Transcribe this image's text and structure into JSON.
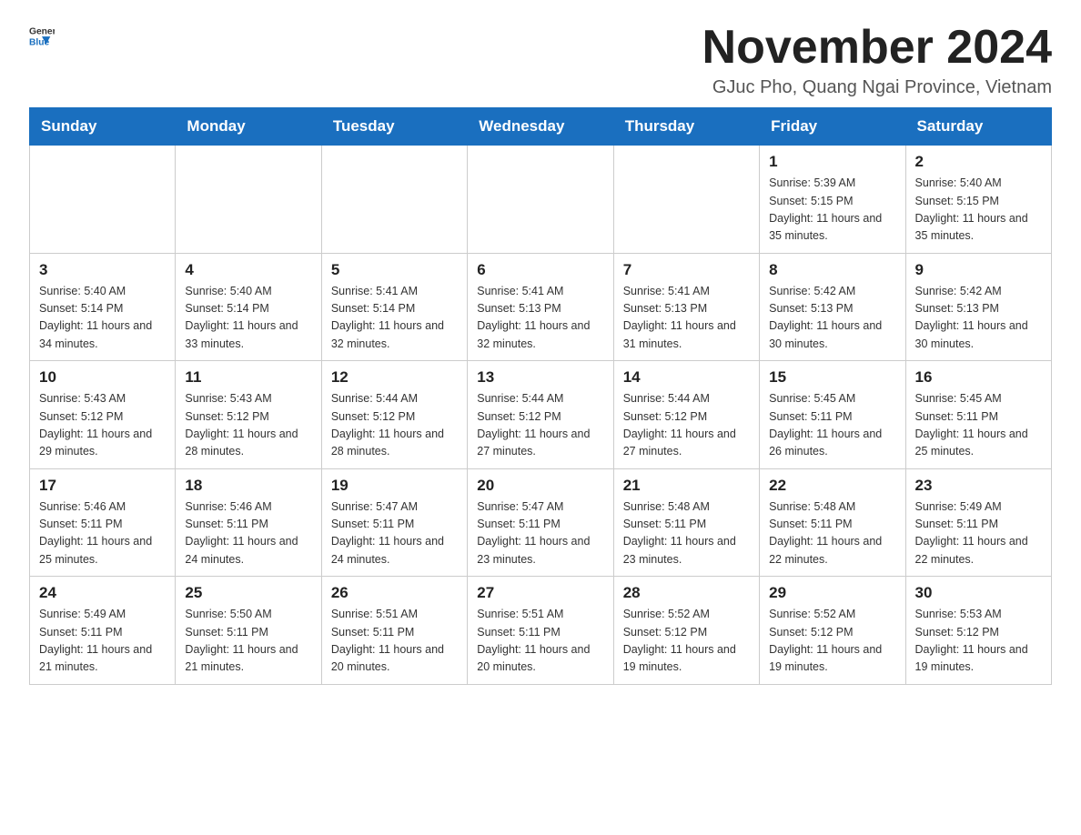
{
  "logo": {
    "general": "General",
    "blue": "Blue"
  },
  "header": {
    "title": "November 2024",
    "subtitle": "GJuc Pho, Quang Ngai Province, Vietnam"
  },
  "weekdays": [
    "Sunday",
    "Monday",
    "Tuesday",
    "Wednesday",
    "Thursday",
    "Friday",
    "Saturday"
  ],
  "weeks": [
    [
      {
        "day": "",
        "sunrise": "",
        "sunset": "",
        "daylight": ""
      },
      {
        "day": "",
        "sunrise": "",
        "sunset": "",
        "daylight": ""
      },
      {
        "day": "",
        "sunrise": "",
        "sunset": "",
        "daylight": ""
      },
      {
        "day": "",
        "sunrise": "",
        "sunset": "",
        "daylight": ""
      },
      {
        "day": "",
        "sunrise": "",
        "sunset": "",
        "daylight": ""
      },
      {
        "day": "1",
        "sunrise": "Sunrise: 5:39 AM",
        "sunset": "Sunset: 5:15 PM",
        "daylight": "Daylight: 11 hours and 35 minutes."
      },
      {
        "day": "2",
        "sunrise": "Sunrise: 5:40 AM",
        "sunset": "Sunset: 5:15 PM",
        "daylight": "Daylight: 11 hours and 35 minutes."
      }
    ],
    [
      {
        "day": "3",
        "sunrise": "Sunrise: 5:40 AM",
        "sunset": "Sunset: 5:14 PM",
        "daylight": "Daylight: 11 hours and 34 minutes."
      },
      {
        "day": "4",
        "sunrise": "Sunrise: 5:40 AM",
        "sunset": "Sunset: 5:14 PM",
        "daylight": "Daylight: 11 hours and 33 minutes."
      },
      {
        "day": "5",
        "sunrise": "Sunrise: 5:41 AM",
        "sunset": "Sunset: 5:14 PM",
        "daylight": "Daylight: 11 hours and 32 minutes."
      },
      {
        "day": "6",
        "sunrise": "Sunrise: 5:41 AM",
        "sunset": "Sunset: 5:13 PM",
        "daylight": "Daylight: 11 hours and 32 minutes."
      },
      {
        "day": "7",
        "sunrise": "Sunrise: 5:41 AM",
        "sunset": "Sunset: 5:13 PM",
        "daylight": "Daylight: 11 hours and 31 minutes."
      },
      {
        "day": "8",
        "sunrise": "Sunrise: 5:42 AM",
        "sunset": "Sunset: 5:13 PM",
        "daylight": "Daylight: 11 hours and 30 minutes."
      },
      {
        "day": "9",
        "sunrise": "Sunrise: 5:42 AM",
        "sunset": "Sunset: 5:13 PM",
        "daylight": "Daylight: 11 hours and 30 minutes."
      }
    ],
    [
      {
        "day": "10",
        "sunrise": "Sunrise: 5:43 AM",
        "sunset": "Sunset: 5:12 PM",
        "daylight": "Daylight: 11 hours and 29 minutes."
      },
      {
        "day": "11",
        "sunrise": "Sunrise: 5:43 AM",
        "sunset": "Sunset: 5:12 PM",
        "daylight": "Daylight: 11 hours and 28 minutes."
      },
      {
        "day": "12",
        "sunrise": "Sunrise: 5:44 AM",
        "sunset": "Sunset: 5:12 PM",
        "daylight": "Daylight: 11 hours and 28 minutes."
      },
      {
        "day": "13",
        "sunrise": "Sunrise: 5:44 AM",
        "sunset": "Sunset: 5:12 PM",
        "daylight": "Daylight: 11 hours and 27 minutes."
      },
      {
        "day": "14",
        "sunrise": "Sunrise: 5:44 AM",
        "sunset": "Sunset: 5:12 PM",
        "daylight": "Daylight: 11 hours and 27 minutes."
      },
      {
        "day": "15",
        "sunrise": "Sunrise: 5:45 AM",
        "sunset": "Sunset: 5:11 PM",
        "daylight": "Daylight: 11 hours and 26 minutes."
      },
      {
        "day": "16",
        "sunrise": "Sunrise: 5:45 AM",
        "sunset": "Sunset: 5:11 PM",
        "daylight": "Daylight: 11 hours and 25 minutes."
      }
    ],
    [
      {
        "day": "17",
        "sunrise": "Sunrise: 5:46 AM",
        "sunset": "Sunset: 5:11 PM",
        "daylight": "Daylight: 11 hours and 25 minutes."
      },
      {
        "day": "18",
        "sunrise": "Sunrise: 5:46 AM",
        "sunset": "Sunset: 5:11 PM",
        "daylight": "Daylight: 11 hours and 24 minutes."
      },
      {
        "day": "19",
        "sunrise": "Sunrise: 5:47 AM",
        "sunset": "Sunset: 5:11 PM",
        "daylight": "Daylight: 11 hours and 24 minutes."
      },
      {
        "day": "20",
        "sunrise": "Sunrise: 5:47 AM",
        "sunset": "Sunset: 5:11 PM",
        "daylight": "Daylight: 11 hours and 23 minutes."
      },
      {
        "day": "21",
        "sunrise": "Sunrise: 5:48 AM",
        "sunset": "Sunset: 5:11 PM",
        "daylight": "Daylight: 11 hours and 23 minutes."
      },
      {
        "day": "22",
        "sunrise": "Sunrise: 5:48 AM",
        "sunset": "Sunset: 5:11 PM",
        "daylight": "Daylight: 11 hours and 22 minutes."
      },
      {
        "day": "23",
        "sunrise": "Sunrise: 5:49 AM",
        "sunset": "Sunset: 5:11 PM",
        "daylight": "Daylight: 11 hours and 22 minutes."
      }
    ],
    [
      {
        "day": "24",
        "sunrise": "Sunrise: 5:49 AM",
        "sunset": "Sunset: 5:11 PM",
        "daylight": "Daylight: 11 hours and 21 minutes."
      },
      {
        "day": "25",
        "sunrise": "Sunrise: 5:50 AM",
        "sunset": "Sunset: 5:11 PM",
        "daylight": "Daylight: 11 hours and 21 minutes."
      },
      {
        "day": "26",
        "sunrise": "Sunrise: 5:51 AM",
        "sunset": "Sunset: 5:11 PM",
        "daylight": "Daylight: 11 hours and 20 minutes."
      },
      {
        "day": "27",
        "sunrise": "Sunrise: 5:51 AM",
        "sunset": "Sunset: 5:11 PM",
        "daylight": "Daylight: 11 hours and 20 minutes."
      },
      {
        "day": "28",
        "sunrise": "Sunrise: 5:52 AM",
        "sunset": "Sunset: 5:12 PM",
        "daylight": "Daylight: 11 hours and 19 minutes."
      },
      {
        "day": "29",
        "sunrise": "Sunrise: 5:52 AM",
        "sunset": "Sunset: 5:12 PM",
        "daylight": "Daylight: 11 hours and 19 minutes."
      },
      {
        "day": "30",
        "sunrise": "Sunrise: 5:53 AM",
        "sunset": "Sunset: 5:12 PM",
        "daylight": "Daylight: 11 hours and 19 minutes."
      }
    ]
  ]
}
